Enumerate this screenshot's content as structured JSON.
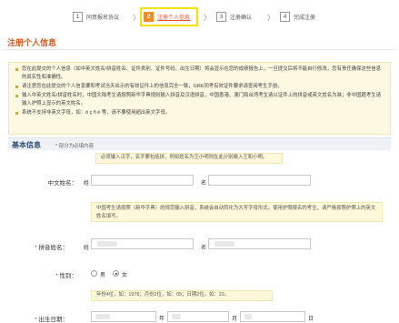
{
  "steps": [
    {
      "num": "1",
      "label": "同意报名协议"
    },
    {
      "num": "2",
      "label": "注册个人信息"
    },
    {
      "num": "3",
      "label": "注册确认"
    },
    {
      "num": "4",
      "label": "完成注册"
    }
  ],
  "separator": "〉",
  "page_title": "注册个人信息",
  "notice": [
    "您在此提交的个人信息（如中英文姓名/拼音姓名、证件类别、证件号码、出生日期）将会显示在您的成绩报告上，一旦提交后将不能自行修改，您有责任确保这些信息的真实性和准确性。",
    "请注意您在此提交的个人信息要和考试当天出示的有效证件上的信息完全一致，GRE同考有效证件要求请查阅考生手册。",
    "输入中英文姓名/拼音姓名时，中国大陆考生请按照新华字典规则输入拼音及汉语拼音，中国香港、澳门和台湾考生请以证件上的拼音或英文姓名为准；非中国籍考生请输入护照上显示的英文姓名。",
    "系统不支持非英文字母，如：ö ç ñ é 等，请不要使用超出英文字母。"
  ],
  "section": {
    "title": "基本信息",
    "subtitle": "* 部分为必填内容"
  },
  "chinese_name": {
    "hint": "必须输入汉字，名字要包括拼，例如姓名为王小明则在此分别输入王和小明。",
    "label": "中文姓名：",
    "surname_label": "姓",
    "given_label": "名"
  },
  "pinyin_name": {
    "hint": "中国考生请按照（新华字典）的规范输入拼音，系统会自动转化为大写字母形式。使用护照报名的考生，请严格按照护照上的英文姓名填写。",
    "label": "拼音姓名：",
    "surname_label": "姓",
    "given_label": "名"
  },
  "gender": {
    "label": "性别：",
    "options": [
      "男",
      "女"
    ],
    "selected": "女"
  },
  "birth_hint": "年份4位，如：1978；月份2位，如：05；日期2位，如：22。",
  "birth": {
    "label": "出生日期：",
    "year": "年",
    "month": "月",
    "day": "日"
  }
}
